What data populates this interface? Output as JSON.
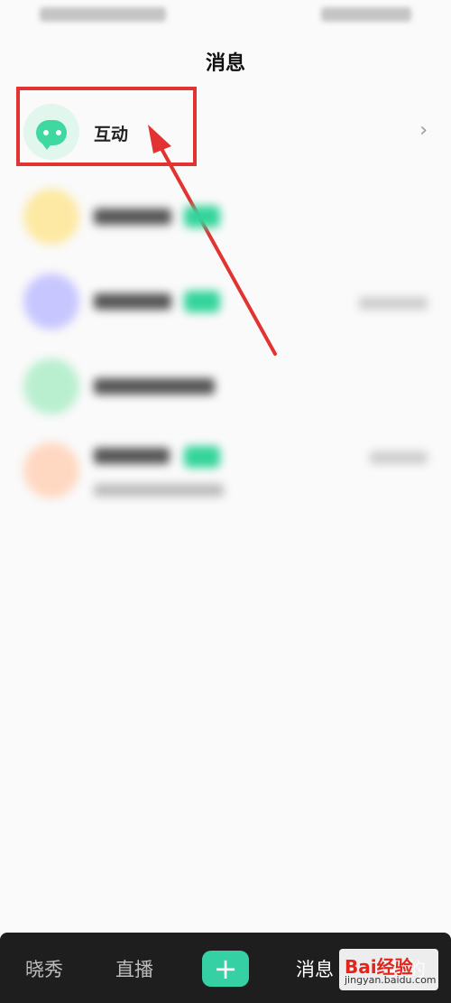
{
  "page": {
    "title": "消息"
  },
  "interaction": {
    "label": "互动",
    "chevron": "›"
  },
  "icons": {
    "interaction_icon": "chat-bubble-icon",
    "add_icon": "plus-icon"
  },
  "colors": {
    "accent": "#36d0a5",
    "highlight": "#e33232",
    "nav_bg": "#1e1e1e"
  },
  "bottom_nav": {
    "home": "晓秀",
    "live": "直播",
    "add": "+",
    "messages": "消息",
    "mine": "我的"
  },
  "watermark": {
    "main": "Bai经验",
    "sub": "jingyan.baidu.com"
  }
}
